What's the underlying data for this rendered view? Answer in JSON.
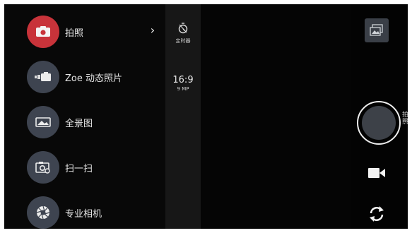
{
  "modes": [
    {
      "label": "拍照",
      "icon": "camera-icon",
      "active": true
    },
    {
      "label": "Zoe 动态照片",
      "icon": "zoe-icon",
      "active": false
    },
    {
      "label": "全景图",
      "icon": "panorama-icon",
      "active": false
    },
    {
      "label": "扫一扫",
      "icon": "scan-icon",
      "active": false
    },
    {
      "label": "专业相机",
      "icon": "aperture-icon",
      "active": false
    }
  ],
  "settings": {
    "timer_label": "定时器",
    "aspect_ratio": "16:9",
    "megapixels": "9 MP"
  },
  "controls": {
    "shutter_label": "拍照"
  },
  "colors": {
    "active_mode": "#c8333a",
    "mode_icon_bg": "#3e4450"
  }
}
